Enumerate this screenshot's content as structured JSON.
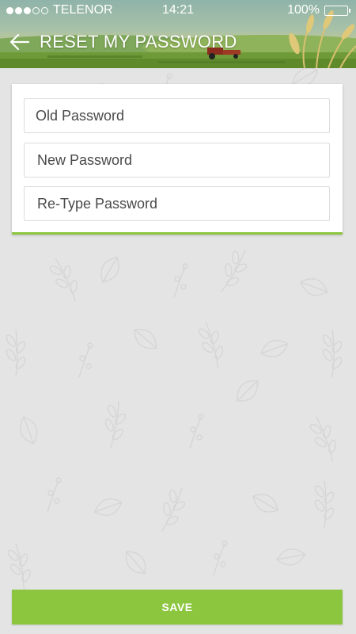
{
  "status_bar": {
    "carrier": "TELENOR",
    "time": "14:21",
    "battery": "100%",
    "signal_full": 3,
    "signal_empty": 2
  },
  "header": {
    "title": "RESET MY PASSWORD",
    "back_icon": "arrow-left-icon"
  },
  "form": {
    "old_password_placeholder": "Old Password",
    "new_password_placeholder": "New Password",
    "retype_password_placeholder": "Re-Type Password"
  },
  "actions": {
    "save_label": "SAVE"
  },
  "colors": {
    "accent": "#8cc63f",
    "background": "#e4e4e4",
    "text": "#4a4a4a"
  }
}
